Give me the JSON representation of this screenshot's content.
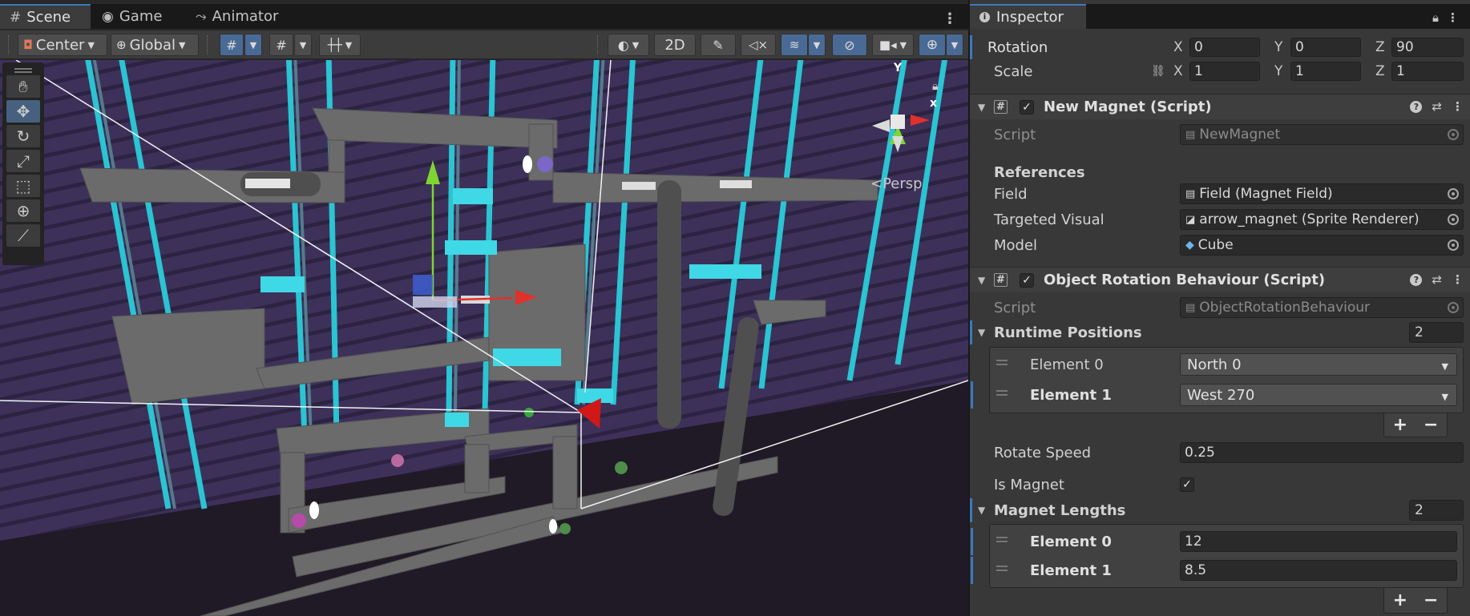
{
  "tabs": {
    "scene": "Scene",
    "game": "Game",
    "animator": "Animator",
    "scene_icon": "grid-icon",
    "game_icon": "gamepad-icon",
    "animator_icon": "animator-icon"
  },
  "scene_toolbar": {
    "pivot_mode": "Center",
    "pivot_rotation": "Global",
    "view_2d": "2D",
    "view_mode": "Persp"
  },
  "inspector": {
    "tab_label": "Inspector",
    "transform": {
      "rotation_label": "Rotation",
      "rotation": {
        "x": "0",
        "y": "0",
        "z": "90"
      },
      "scale_label": "Scale",
      "scale": {
        "x": "1",
        "y": "1",
        "z": "1"
      },
      "axis_x": "X",
      "axis_y": "Y",
      "axis_z": "Z"
    },
    "new_magnet": {
      "title": "New Magnet (Script)",
      "script_label": "Script",
      "script_value": "NewMagnet",
      "references_header": "References",
      "field_label": "Field",
      "field_value": "Field (Magnet Field)",
      "targeted_visual_label": "Targeted Visual",
      "targeted_visual_value": "arrow_magnet (Sprite Renderer)",
      "model_label": "Model",
      "model_value": "Cube"
    },
    "object_rotation": {
      "title": "Object Rotation Behaviour (Script)",
      "script_label": "Script",
      "script_value": "ObjectRotationBehaviour",
      "runtime_positions_label": "Runtime Positions",
      "runtime_positions_count": "2",
      "runtime_positions": [
        {
          "label": "Element 0",
          "value": "North 0"
        },
        {
          "label": "Element 1",
          "value": "West 270"
        }
      ],
      "rotate_speed_label": "Rotate Speed",
      "rotate_speed_value": "0.25",
      "is_magnet_label": "Is Magnet",
      "is_magnet_checked": true,
      "magnet_lengths_label": "Magnet Lengths",
      "magnet_lengths_count": "2",
      "magnet_lengths": [
        {
          "label": "Element 0",
          "value": "12"
        },
        {
          "label": "Element 1",
          "value": "8.5"
        }
      ]
    },
    "add_symbol": "+",
    "remove_symbol": "−"
  },
  "colors": {
    "accent": "#3a79bb",
    "panel_bg": "#383838",
    "viewport_bg": "#3a2f55",
    "cyan": "#3fd8e6",
    "gizmo_x": "#e0322b",
    "gizmo_y": "#7ed532",
    "gizmo_z": "#3d62d8"
  }
}
